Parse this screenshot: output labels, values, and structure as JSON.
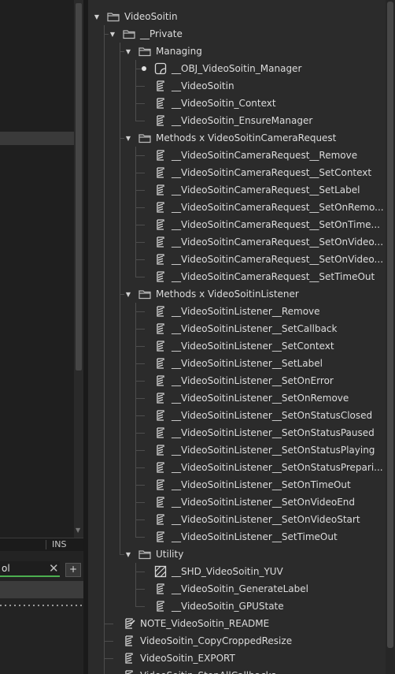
{
  "left_panel": {
    "status_text": "INS",
    "tab_input_value": "ol",
    "tab_add_label": "+",
    "tab_close_label": "✕"
  },
  "tree": [
    {
      "label": "VideoSoitin",
      "type": "folder",
      "level": 0,
      "expanded": true
    },
    {
      "label": "__Private",
      "type": "folder",
      "level": 1,
      "expanded": true
    },
    {
      "label": "Managing",
      "type": "folder",
      "level": 2,
      "expanded": true
    },
    {
      "label": "__OBJ_VideoSoitin_Manager",
      "type": "object",
      "level": 3,
      "bullet": true
    },
    {
      "label": "__VideoSoitin",
      "type": "script",
      "level": 3
    },
    {
      "label": "__VideoSoitin_Context",
      "type": "script",
      "level": 3
    },
    {
      "label": "__VideoSoitin_EnsureManager",
      "type": "script",
      "level": 3
    },
    {
      "label": "Methods x VideoSoitinCameraRequest",
      "type": "folder",
      "level": 2,
      "expanded": true
    },
    {
      "label": "__VideoSoitinCameraRequest__Remove",
      "type": "script",
      "level": 3
    },
    {
      "label": "__VideoSoitinCameraRequest__SetContext",
      "type": "script",
      "level": 3
    },
    {
      "label": "__VideoSoitinCameraRequest__SetLabel",
      "type": "script",
      "level": 3
    },
    {
      "label": "__VideoSoitinCameraRequest__SetOnRemo...",
      "type": "script",
      "level": 3
    },
    {
      "label": "__VideoSoitinCameraRequest__SetOnTime...",
      "type": "script",
      "level": 3
    },
    {
      "label": "__VideoSoitinCameraRequest__SetOnVideo...",
      "type": "script",
      "level": 3
    },
    {
      "label": "__VideoSoitinCameraRequest__SetOnVideo...",
      "type": "script",
      "level": 3
    },
    {
      "label": "__VideoSoitinCameraRequest__SetTimeOut",
      "type": "script",
      "level": 3
    },
    {
      "label": "Methods x VideoSoitinListener",
      "type": "folder",
      "level": 2,
      "expanded": true
    },
    {
      "label": "__VideoSoitinListener__Remove",
      "type": "script",
      "level": 3
    },
    {
      "label": "__VideoSoitinListener__SetCallback",
      "type": "script",
      "level": 3
    },
    {
      "label": "__VideoSoitinListener__SetContext",
      "type": "script",
      "level": 3
    },
    {
      "label": "__VideoSoitinListener__SetLabel",
      "type": "script",
      "level": 3
    },
    {
      "label": "__VideoSoitinListener__SetOnError",
      "type": "script",
      "level": 3
    },
    {
      "label": "__VideoSoitinListener__SetOnRemove",
      "type": "script",
      "level": 3
    },
    {
      "label": "__VideoSoitinListener__SetOnStatusClosed",
      "type": "script",
      "level": 3
    },
    {
      "label": "__VideoSoitinListener__SetOnStatusPaused",
      "type": "script",
      "level": 3
    },
    {
      "label": "__VideoSoitinListener__SetOnStatusPlaying",
      "type": "script",
      "level": 3
    },
    {
      "label": "__VideoSoitinListener__SetOnStatusPrepari...",
      "type": "script",
      "level": 3
    },
    {
      "label": "__VideoSoitinListener__SetOnTimeOut",
      "type": "script",
      "level": 3
    },
    {
      "label": "__VideoSoitinListener__SetOnVideoEnd",
      "type": "script",
      "level": 3
    },
    {
      "label": "__VideoSoitinListener__SetOnVideoStart",
      "type": "script",
      "level": 3
    },
    {
      "label": "__VideoSoitinListener__SetTimeOut",
      "type": "script",
      "level": 3
    },
    {
      "label": "Utility",
      "type": "folder",
      "level": 2,
      "expanded": true
    },
    {
      "label": "__SHD_VideoSoitin_YUV",
      "type": "shader",
      "level": 3
    },
    {
      "label": "__VideoSoitin_GenerateLabel",
      "type": "script",
      "level": 3
    },
    {
      "label": "__VideoSoitin_GPUState",
      "type": "script",
      "level": 3
    },
    {
      "label": "NOTE_VideoSoitin_README",
      "type": "note",
      "level": 1
    },
    {
      "label": "VideoSoitin_CopyCroppedResize",
      "type": "script",
      "level": 1
    },
    {
      "label": "VideoSoitin_EXPORT",
      "type": "script",
      "level": 1
    },
    {
      "label": "VideoSoitin_StopAllCallbacks",
      "type": "script",
      "level": 1
    }
  ],
  "icon_names": {
    "folder": "folder-icon",
    "script": "script-icon",
    "object": "object-icon",
    "shader": "shader-icon",
    "note": "note-icon"
  },
  "colors": {
    "accent_green": "#4caf50",
    "panel_bg": "#2b2b2b",
    "text": "#dcdcdc"
  }
}
